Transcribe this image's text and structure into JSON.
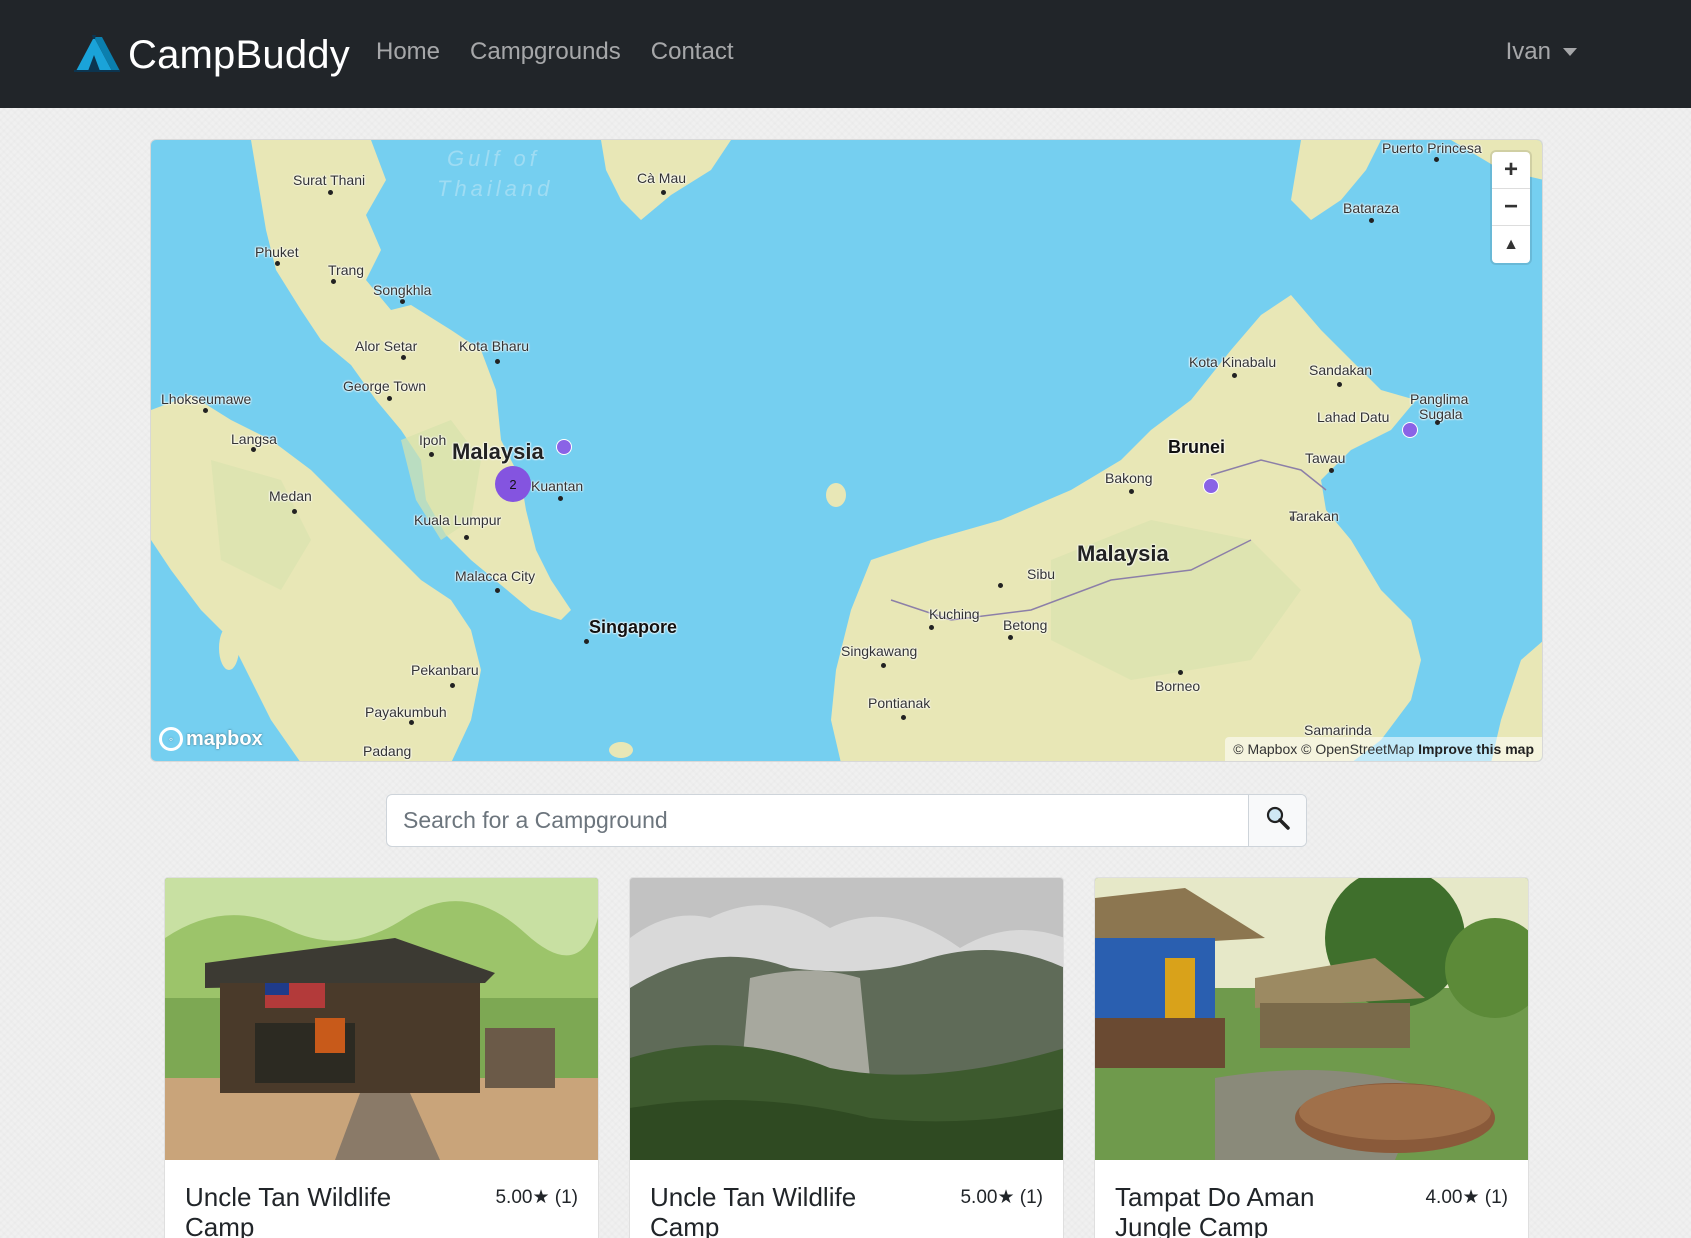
{
  "brand": {
    "name": "CampBuddy",
    "logo_icon": "tent-icon"
  },
  "nav": {
    "links": [
      "Home",
      "Campgrounds",
      "Contact"
    ],
    "user": "Ivan"
  },
  "map": {
    "sea_labels": {
      "gulf1": "Gulf of",
      "gulf2": "Thailand"
    },
    "places": {
      "surat_thani": "Surat Thani",
      "ca_mau": "Cà Mau",
      "puerto_princesa": "Puerto Princesa",
      "bataraza": "Bataraza",
      "phuket": "Phuket",
      "trang": "Trang",
      "songkhla": "Songkhla",
      "alor_setar": "Alor Setar",
      "kota_bharu": "Kota Bharu",
      "george_town": "George Town",
      "lhokseumawe": "Lhokseumawe",
      "langsa": "Langsa",
      "ipoh": "Ipoh",
      "malaysia_w": "Malaysia",
      "kuantan": "Kuantan",
      "medan": "Medan",
      "kuala_lumpur": "Kuala Lumpur",
      "malacca": "Malacca City",
      "singapore": "Singapore",
      "pekanbaru": "Pekanbaru",
      "payakumbuh": "Payakumbuh",
      "padang": "Padang",
      "kota_kinabalu": "Kota Kinabalu",
      "sandakan": "Sandakan",
      "panglima1": "Panglima",
      "panglima2": "Sugala",
      "lahad_datu": "Lahad Datu",
      "brunei": "Brunei",
      "bakong": "Bakong",
      "tawau": "Tawau",
      "tarakan": "Tarakan",
      "sibu": "Sibu",
      "malaysia_e": "Malaysia",
      "kuching": "Kuching",
      "betong": "Betong",
      "singkawang": "Singkawang",
      "borneo": "Borneo",
      "pontianak": "Pontianak",
      "samarinda": "Samarinda"
    },
    "cluster_count": "2",
    "controls": {
      "zoom_in": "+",
      "zoom_out": "−",
      "compass": "▲"
    },
    "logo": "mapbox",
    "attribution": {
      "text": "© Mapbox © OpenStreetMap",
      "improve": "Improve this map"
    }
  },
  "search": {
    "placeholder": "Search for a Campground",
    "icon": "search-icon"
  },
  "campgrounds": [
    {
      "title": "Uncle Tan Wildlife Camp",
      "rating": "5.00★ (1)"
    },
    {
      "title": "Uncle Tan Wildlife Camp",
      "rating": "5.00★ (1)"
    },
    {
      "title": "Tampat Do Aman Jungle Camp",
      "rating": "4.00★ (1)"
    }
  ]
}
